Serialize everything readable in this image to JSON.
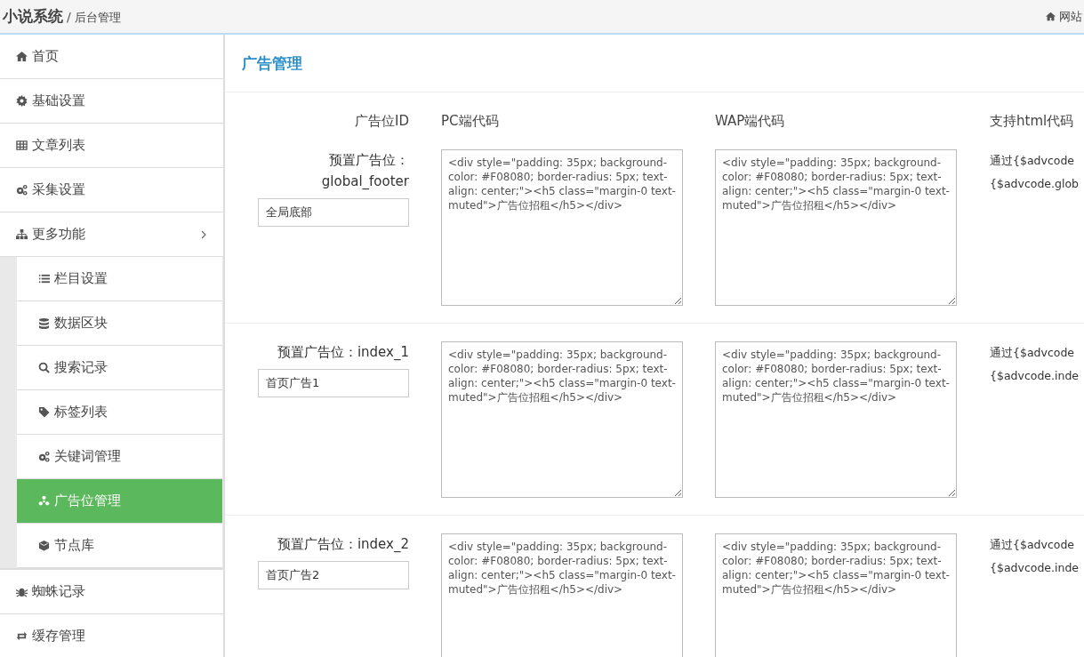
{
  "header": {
    "brand": "小说系统",
    "separator": "/",
    "subtitle": "后台管理",
    "site_link": "网站"
  },
  "sidebar": {
    "items": [
      {
        "label": "首页",
        "selected": false
      },
      {
        "label": "基础设置",
        "selected": false
      },
      {
        "label": "文章列表",
        "selected": false
      },
      {
        "label": "采集设置",
        "selected": false
      },
      {
        "label": "更多功能",
        "selected": false,
        "expanded": true,
        "children": [
          {
            "label": "栏目设置",
            "selected": false
          },
          {
            "label": "数据区块",
            "selected": false
          },
          {
            "label": "搜索记录",
            "selected": false
          },
          {
            "label": "标签列表",
            "selected": false
          },
          {
            "label": "关键词管理",
            "selected": false
          },
          {
            "label": "广告位管理",
            "selected": true
          },
          {
            "label": "节点库",
            "selected": false
          }
        ]
      },
      {
        "label": "蜘蛛记录",
        "selected": false
      },
      {
        "label": "缓存管理",
        "selected": false
      }
    ]
  },
  "page": {
    "title": "广告管理",
    "columns": [
      "广告位ID",
      "PC端代码",
      "WAP端代码",
      "支持html代码"
    ],
    "rows": [
      {
        "label": "预置广告位：global_footer",
        "name": "全局底部",
        "pc_code": "<div style=\"padding: 35px; background-color: #F08080; border-radius: 5px; text-align: center;\"><h5 class=\"margin-0 text-muted\">广告位招租</h5></div>",
        "wap_code": "<div style=\"padding: 35px; background-color: #F08080; border-radius: 5px; text-align: center;\"><h5 class=\"margin-0 text-muted\">广告位招租</h5></div>",
        "usage": [
          "通过{$advcode",
          "{$advcode.glob"
        ]
      },
      {
        "label": "预置广告位：index_1",
        "name": "首页广告1",
        "pc_code": "<div style=\"padding: 35px; background-color: #F08080; border-radius: 5px; text-align: center;\"><h5 class=\"margin-0 text-muted\">广告位招租</h5></div>",
        "wap_code": "<div style=\"padding: 35px; background-color: #F08080; border-radius: 5px; text-align: center;\"><h5 class=\"margin-0 text-muted\">广告位招租</h5></div>",
        "usage": [
          "通过{$advcode",
          "{$advcode.inde"
        ]
      },
      {
        "label": "预置广告位：index_2",
        "name": "首页广告2",
        "pc_code": "<div style=\"padding: 35px; background-color: #F08080; border-radius: 5px; text-align: center;\"><h5 class=\"margin-0 text-muted\">广告位招租</h5></div>",
        "wap_code": "<div style=\"padding: 35px; background-color: #F08080; border-radius: 5px; text-align: center;\"><h5 class=\"margin-0 text-muted\">广告位招租</h5></div>",
        "usage": [
          "通过{$advcode",
          "{$advcode.inde"
        ]
      }
    ]
  }
}
